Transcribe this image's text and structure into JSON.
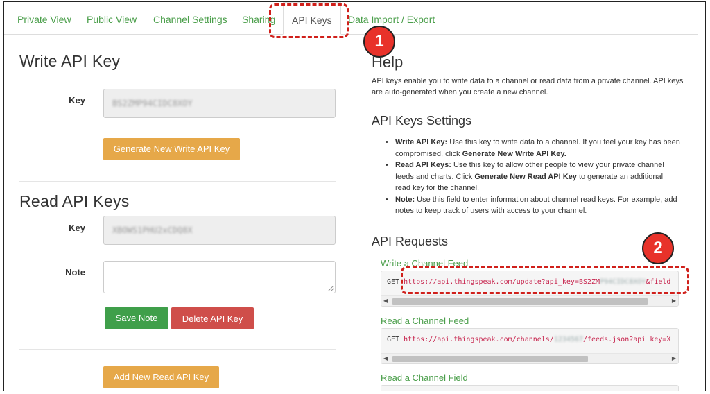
{
  "tabs": {
    "items": [
      {
        "label": "Private View"
      },
      {
        "label": "Public View"
      },
      {
        "label": "Channel Settings"
      },
      {
        "label": "Sharing"
      },
      {
        "label": "API Keys"
      },
      {
        "label": "Data Import / Export"
      }
    ],
    "active": "API Keys"
  },
  "callouts": {
    "one": "1",
    "two": "2"
  },
  "write_section": {
    "title": "Write API Key",
    "key_label": "Key",
    "key_value": "BS2ZMP94CIDC8XOY",
    "generate_button": "Generate New Write API Key"
  },
  "read_section": {
    "title": "Read API Keys",
    "key_label": "Key",
    "key_value": "XBOWS1PHU2xCDQ8X",
    "note_label": "Note",
    "note_value": "",
    "save_button": "Save Note",
    "delete_button": "Delete API Key",
    "add_button": "Add New Read API Key"
  },
  "help": {
    "title": "Help",
    "intro": "API keys enable you to write data to a channel or read data from a private channel. API keys are auto-generated when you create a new channel.",
    "settings_title": "API Keys Settings",
    "bullets": [
      {
        "bold": "Write API Key:",
        "text": " Use this key to write data to a channel. If you feel your key has been compromised, click ",
        "bold2": "Generate New Write API Key.",
        "text2": ""
      },
      {
        "bold": "Read API Keys:",
        "text": " Use this key to allow other people to view your private channel feeds and charts. Click ",
        "bold2": "Generate New Read API Key",
        "text2": " to generate an additional read key for the channel."
      },
      {
        "bold": "Note:",
        "text": " Use this field to enter information about channel read keys. For example, add notes to keep track of users with access to your channel.",
        "bold2": "",
        "text2": ""
      }
    ],
    "requests_title": "API Requests",
    "requests": [
      {
        "label": "Write a Channel Feed",
        "method": "GET",
        "url": "https://api.thingspeak.com/update?api_key=BS2ZM",
        "blurred": "P94CIDC8XOY",
        "url_tail": "&field"
      },
      {
        "label": "Read a Channel Feed",
        "method": "GET",
        "url": "https://api.thingspeak.com/channels/",
        "blurred": "1234567",
        "url_tail": "/feeds.json?api_key=X"
      },
      {
        "label": "Read a Channel Field"
      }
    ]
  },
  "colors": {
    "accent_green": "#4a9e4a",
    "button_orange": "#e6a849",
    "button_green": "#3f9f4a",
    "button_red": "#cf4e4a",
    "callout_red": "#d0201b"
  }
}
